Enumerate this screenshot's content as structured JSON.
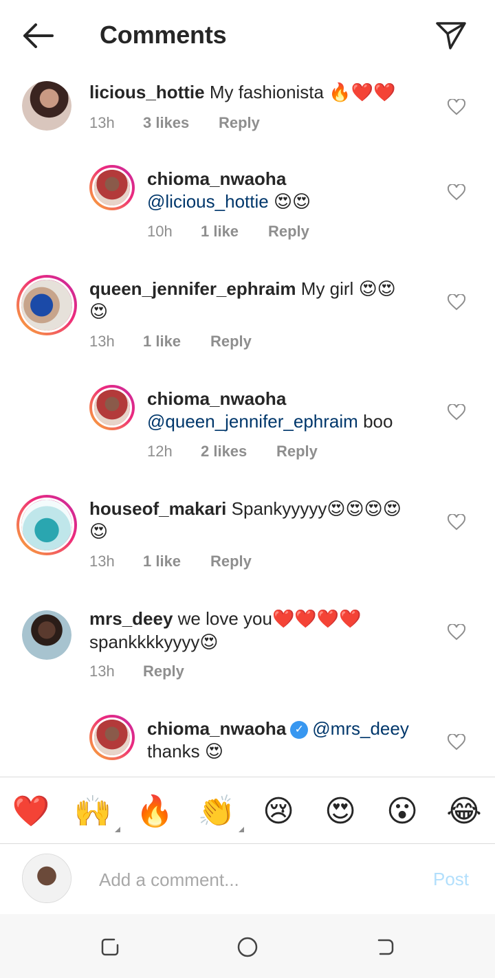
{
  "header": {
    "title": "Comments"
  },
  "comments": [
    {
      "username": "licious_hottie",
      "text": "My fashionista",
      "emoji": "🔥❤️❤️",
      "time": "13h",
      "likes": "3 likes",
      "reply": "Reply"
    },
    {
      "username": "chioma_nwaoha",
      "mention": "@licious_hottie",
      "text": "",
      "emoji": "😍😍",
      "time": "10h",
      "likes": "1 like",
      "reply": "Reply"
    },
    {
      "username": "queen_jennifer_ephraim",
      "text": "My girl",
      "emoji": "😍😍",
      "emoji2": "😍",
      "time": "13h",
      "likes": "1 like",
      "reply": "Reply"
    },
    {
      "username": "chioma_nwaoha",
      "mention": "@queen_jennifer_ephraim",
      "text": "boo",
      "time": "12h",
      "likes": "2 likes",
      "reply": "Reply"
    },
    {
      "username": "houseof_makari",
      "text": "Spankyyyyy",
      "emoji": "😍😍😍😍",
      "emoji2": "😍",
      "time": "13h",
      "likes": "1 like",
      "reply": "Reply"
    },
    {
      "username": "mrs_deey",
      "text": "we love you",
      "emoji": "❤️❤️❤️❤️",
      "text2": "spankkkkyyyy",
      "emoji2": "😍",
      "time": "13h",
      "reply": "Reply"
    },
    {
      "username": "chioma_nwaoha",
      "verified": "✓",
      "mention": "@mrs_deey",
      "text2": "thanks",
      "emoji2": "😍"
    }
  ],
  "emoji_bar": [
    "❤️",
    "🙌",
    "🔥",
    "👏",
    "😢",
    "😍",
    "😮",
    "😂"
  ],
  "composer": {
    "placeholder": "Add a comment...",
    "post_label": "Post"
  },
  "colors": {
    "mention": "#00376b",
    "muted": "#8e8e8e",
    "post_disabled": "#b2dffc",
    "story_ring": "#ee2a7b"
  }
}
